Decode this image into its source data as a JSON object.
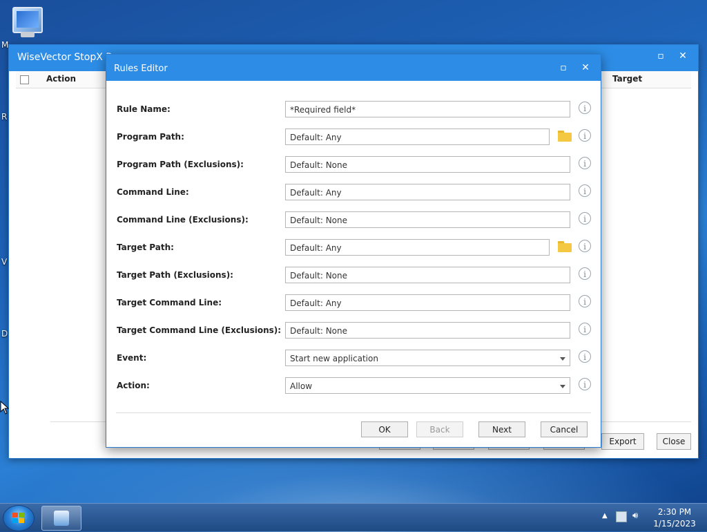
{
  "desktop": {
    "icon_name": "computer-icon",
    "label_fragment": "M",
    "edge_letters": [
      "R",
      "V",
      "D"
    ]
  },
  "main_window": {
    "title": "WiseVector StopX Ru",
    "columns": [
      "Action",
      "Target"
    ],
    "buttons": [
      "Export",
      "Close"
    ]
  },
  "dialog": {
    "title": "Rules Editor",
    "fields": [
      {
        "label": "Rule Name:",
        "value": "*Required field*",
        "kind": "text",
        "browse": false
      },
      {
        "label": "Program Path:",
        "value": "Default: Any",
        "kind": "text",
        "browse": true
      },
      {
        "label": "Program Path (Exclusions):",
        "value": "Default: None",
        "kind": "text",
        "browse": false
      },
      {
        "label": "Command Line:",
        "value": "Default: Any",
        "kind": "text",
        "browse": false
      },
      {
        "label": "Command Line (Exclusions):",
        "value": "Default: None",
        "kind": "text",
        "browse": false
      },
      {
        "label": "Target Path:",
        "value": "Default: Any",
        "kind": "text",
        "browse": true
      },
      {
        "label": "Target Path (Exclusions):",
        "value": "Default: None",
        "kind": "text",
        "browse": false
      },
      {
        "label": "Target Command Line:",
        "value": "Default: Any",
        "kind": "text",
        "browse": false
      },
      {
        "label": "Target Command Line (Exclusions):",
        "value": "Default: None",
        "kind": "text",
        "browse": false
      },
      {
        "label": "Event:",
        "value": "Start new application",
        "kind": "select",
        "browse": false
      },
      {
        "label": "Action:",
        "value": "Allow",
        "kind": "select",
        "browse": false
      }
    ],
    "info_glyph": "i",
    "buttons": {
      "ok": "OK",
      "back": "Back",
      "next": "Next",
      "cancel": "Cancel"
    }
  },
  "taskbar": {
    "time": "2:30 PM",
    "date": "1/15/2023"
  }
}
